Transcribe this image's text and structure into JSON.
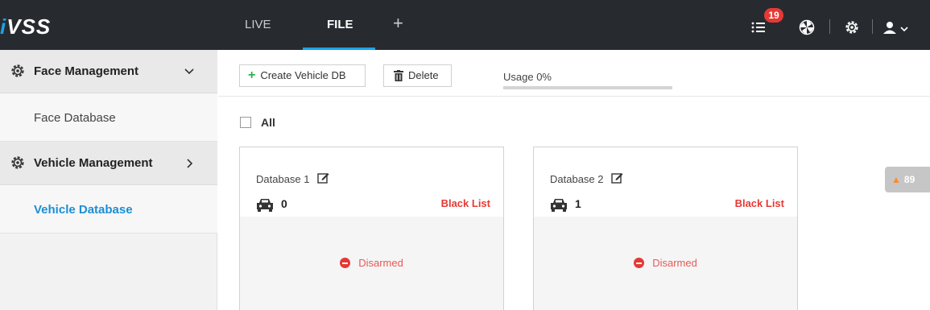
{
  "app": {
    "logo": "iVSS",
    "logo_prefix": "i",
    "logo_rest": "VSS",
    "accent": "#1aa3e8"
  },
  "nav": {
    "tabs": [
      {
        "label": "LIVE"
      },
      {
        "label": "FILE"
      }
    ],
    "add_label": "+",
    "active_tab": "FILE"
  },
  "topbar": {
    "notification_count": "19",
    "icons": [
      "list-icon",
      "fan-icon",
      "gear-icon",
      "user-icon"
    ]
  },
  "sidebar": {
    "groups": [
      {
        "label": "Face Management",
        "chevron": "chevron-down-icon",
        "items": [
          {
            "label": "Face Database"
          }
        ]
      },
      {
        "label": "Vehicle Management",
        "chevron": "chevron-right-icon",
        "items": [
          {
            "label": "Vehicle Database",
            "active": true
          }
        ]
      }
    ]
  },
  "toolbar": {
    "create_label": "Create Vehicle DB",
    "delete_label": "Delete",
    "usage_label": "Usage 0%",
    "usage_percent": 0
  },
  "select_all_label": "All",
  "databases": [
    {
      "name": "Database 1",
      "count": "0",
      "list_type": "Black List",
      "status": "Disarmed"
    },
    {
      "name": "Database 2",
      "count": "1",
      "list_type": "Black List",
      "status": "Disarmed"
    }
  ],
  "alarm": {
    "count": "89",
    "icon": "warning-icon"
  }
}
